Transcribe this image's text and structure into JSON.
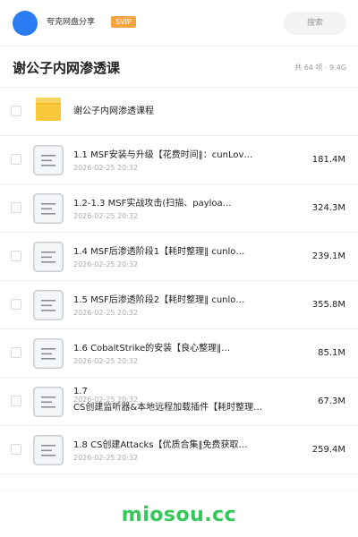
{
  "header": {
    "app_name": "夸克网盘分享",
    "badge": "SVIP",
    "search_placeholder": "搜索",
    "avatar_color": "#2b7bf3"
  },
  "folder": {
    "title": "谢公子内网渗透课",
    "meta": "共 64 项 · 9.4G"
  },
  "items": [
    {
      "type": "folder",
      "name": "谢公子内网渗透课程",
      "date": "2026-02-25 20:32",
      "size": ""
    },
    {
      "type": "file",
      "name": "1.1 MSF安装与升级【花费时间‖：cunLov…",
      "date": "2026-02-25 20:32",
      "size": "181.4M"
    },
    {
      "type": "file",
      "name": "1.2-1.3 MSF实战攻击(扫描、payloa…",
      "date": "2026-02-25 20:32",
      "size": "324.3M"
    },
    {
      "type": "file",
      "name": "1.4 MSF后渗透阶段1【耗时整理‖ cunlo…",
      "date": "2026-02-25 20:32",
      "size": "239.1M"
    },
    {
      "type": "file",
      "name": "1.5 MSF后渗透阶段2【耗时整理‖ cunlo…",
      "date": "2026-02-25 20:32",
      "size": "355.8M"
    },
    {
      "type": "file",
      "name": "1.6 CobaltStrike的安装【良心整理‖…",
      "date": "2026-02-25 20:32",
      "size": "85.1M"
    },
    {
      "type": "file",
      "name_line1": "1.7",
      "name_line2": "CS创建监听器&本地远程加载插件【耗时整理…",
      "date": "2026-02-25 20:32",
      "size": "67.3M"
    },
    {
      "type": "file",
      "name": "1.8 CS创建Attacks【优质合集‖免费获取…",
      "date": "2026-02-25 20:32",
      "size": "259.4M"
    }
  ],
  "footer": {
    "brand": "miosou.cc",
    "brand_color": "#34c759"
  }
}
